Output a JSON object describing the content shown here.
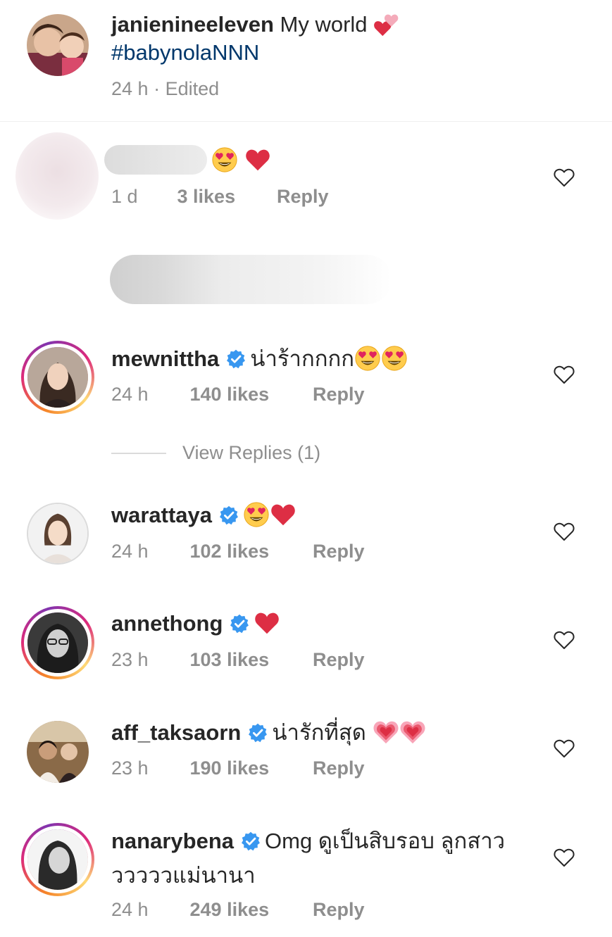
{
  "caption": {
    "username": "janienineeleven",
    "text": "My world",
    "emoji": "two-hearts",
    "hashtag": "#babynolaNNN",
    "time": "24 h",
    "edited": "· Edited"
  },
  "first_comment": {
    "emojis": [
      "heart-eyes",
      "red-heart"
    ],
    "time": "1 d",
    "likes": "3 likes",
    "reply": "Reply"
  },
  "comments": [
    {
      "username": "mewnittha",
      "verified": true,
      "text": "น่าร้ากกกก",
      "emojis": [
        "heart-eyes",
        "heart-eyes"
      ],
      "time": "24 h",
      "likes": "140 likes",
      "reply": "Reply"
    },
    {
      "username": "warattaya",
      "verified": true,
      "text": "",
      "emojis": [
        "heart-eyes",
        "red-heart"
      ],
      "time": "24 h",
      "likes": "102 likes",
      "reply": "Reply"
    },
    {
      "username": "annethong",
      "verified": true,
      "text": "",
      "emojis": [
        "red-heart"
      ],
      "time": "23 h",
      "likes": "103 likes",
      "reply": "Reply"
    },
    {
      "username": "aff_taksaorn",
      "verified": true,
      "text": "น่ารักที่สุด",
      "emojis": [
        "growing-heart",
        "growing-heart"
      ],
      "time": "23 h",
      "likes": "190 likes",
      "reply": "Reply"
    },
    {
      "username": "nanarybena",
      "verified": true,
      "text": "Omg ดูเป็นสิบรอบ ลูกสาว",
      "text_line2": "วววววแม่นานา",
      "emojis": [],
      "time": "24 h",
      "likes": "249 likes",
      "reply": "Reply"
    }
  ],
  "view_replies": "View Replies (1)",
  "colors": {
    "text": "#262626",
    "secondary": "#8e8e8e",
    "hashtag": "#00376b",
    "verified": "#3897f0",
    "heart": "#e0245e"
  }
}
